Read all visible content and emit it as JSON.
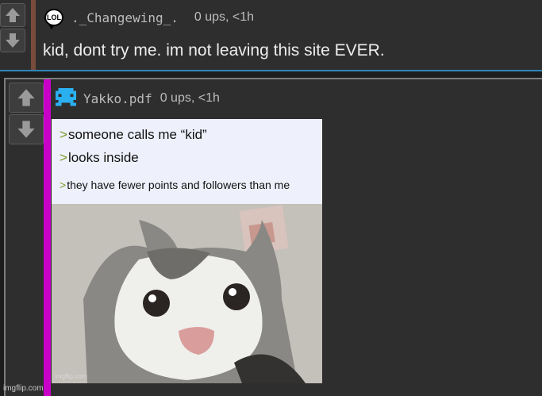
{
  "comment1": {
    "badge_text": "LOL",
    "username": "._Changewing_.",
    "meta": "0 ups, <1h",
    "body": "kid, dont try me. im not leaving this site EVER."
  },
  "comment2": {
    "username": "Yakko.pdf",
    "meta": "0 ups, <1h",
    "meme": {
      "gt_symbol": ">",
      "line1": "someone calls me “kid”",
      "line2": "looks inside",
      "line3": "they have fewer points and followers than me",
      "inner_watermark": "imgflip.com"
    }
  },
  "footer_watermark": "imgflip.com",
  "icons": {
    "upvote": "upvote-arrow-icon",
    "downvote": "downvote-arrow-icon",
    "avatar": "pixel-invader-icon"
  },
  "colors": {
    "comment1_bar": "#7a4b3a",
    "comment2_bar": "#c800c8",
    "comment1_border": "#2f87b8",
    "greentext": "#789922"
  }
}
